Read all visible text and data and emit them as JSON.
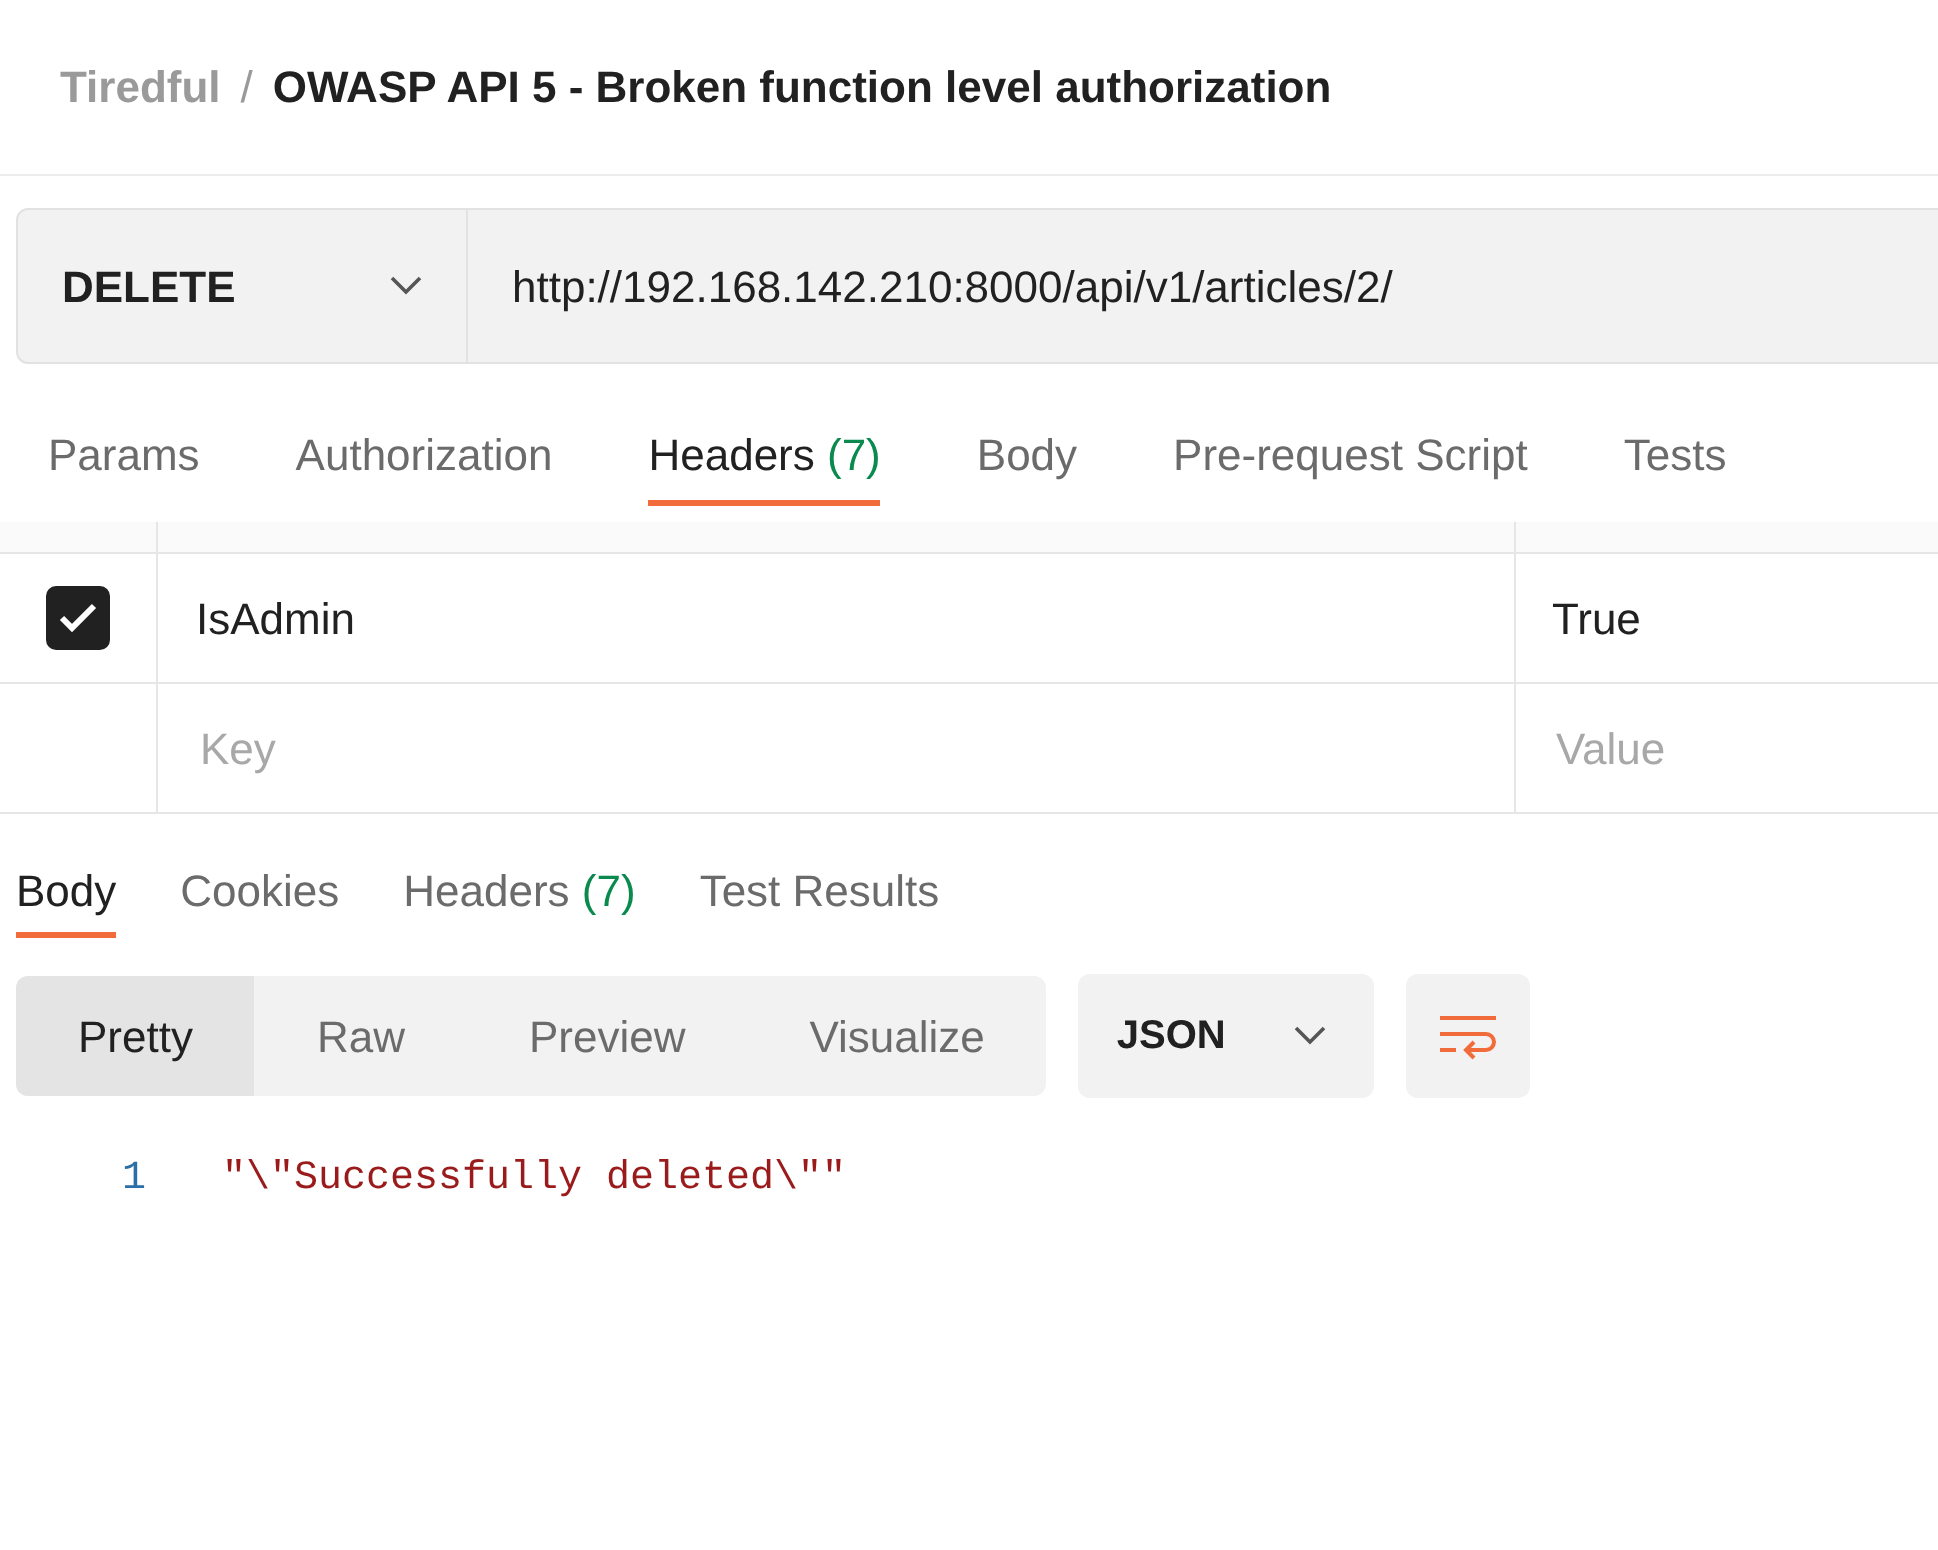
{
  "breadcrumb": {
    "collection": "Tiredful",
    "separator": "/",
    "request_name": "OWASP API 5 - Broken function level authorization"
  },
  "request": {
    "method": "DELETE",
    "url": "http://192.168.142.210:8000/api/v1/articles/2/"
  },
  "request_tabs": [
    {
      "label": "Params",
      "selected": false
    },
    {
      "label": "Authorization",
      "selected": false
    },
    {
      "label": "Headers",
      "count": "(7)",
      "selected": true
    },
    {
      "label": "Body",
      "selected": false
    },
    {
      "label": "Pre-request Script",
      "selected": false
    },
    {
      "label": "Tests",
      "selected": false
    }
  ],
  "headers_table": {
    "rows": [
      {
        "checked": true,
        "key": "IsAdmin",
        "value": "True"
      }
    ],
    "new_row": {
      "key": {
        "placeholder": "Key"
      },
      "value": {
        "placeholder": "Value"
      }
    }
  },
  "response_tabs": [
    {
      "label": "Body",
      "selected": true
    },
    {
      "label": "Cookies",
      "selected": false
    },
    {
      "label": "Headers",
      "count": "(7)",
      "selected": false
    },
    {
      "label": "Test Results",
      "selected": false
    }
  ],
  "view_modes": [
    {
      "label": "Pretty",
      "selected": true
    },
    {
      "label": "Raw",
      "selected": false
    },
    {
      "label": "Preview",
      "selected": false
    },
    {
      "label": "Visualize",
      "selected": false
    }
  ],
  "format": "JSON",
  "body_lines": [
    {
      "number": "1",
      "text": "\"\\\"Successfully deleted\\\"\""
    }
  ]
}
